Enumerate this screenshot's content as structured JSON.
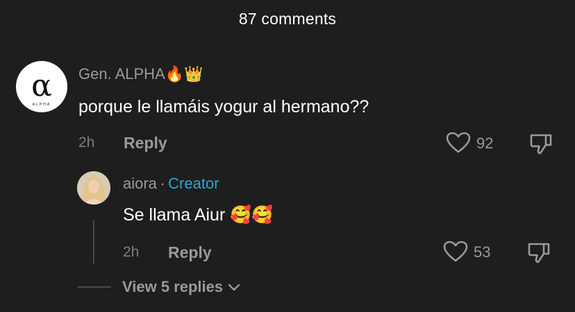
{
  "header": {
    "title": "87 comments"
  },
  "comment": {
    "username": "Gen. ALPHA🔥👑",
    "avatar_logo": "α",
    "avatar_caption": "ALPHA",
    "text": "porque le llamáis yogur al hermano??",
    "time": "2h",
    "reply_label": "Reply",
    "likes": "92",
    "icons": {
      "like": "heart-icon",
      "dislike": "thumbs-down-icon"
    }
  },
  "reply": {
    "username": "aiora",
    "separator": "·",
    "badge": "Creator",
    "text": "Se llama Aiur 🥰🥰",
    "time": "2h",
    "reply_label": "Reply",
    "likes": "53"
  },
  "view_replies": {
    "label": "View 5 replies",
    "icon": "chevron-down-icon"
  },
  "colors": {
    "background": "#1e1e1e",
    "creator_badge": "#2aa8d1",
    "muted_text": "#9a9a9a"
  }
}
